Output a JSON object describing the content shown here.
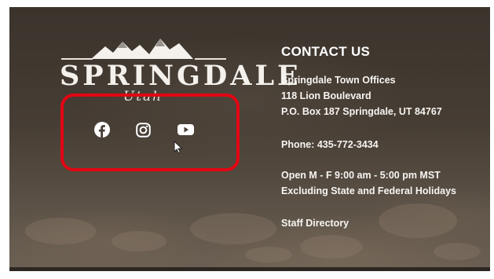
{
  "logo": {
    "wordmark": "SPRINGDALE",
    "script": "Utah"
  },
  "social": [
    {
      "icon": "facebook-icon",
      "label": "Facebook"
    },
    {
      "icon": "instagram-icon",
      "label": "Instagram"
    },
    {
      "icon": "youtube-icon",
      "label": "YouTube"
    }
  ],
  "contact": {
    "heading": "CONTACT US",
    "office_name": "Springdale Town Offices",
    "street": "118 Lion Boulevard",
    "po_box": "P.O. Box 187 Springdale, UT 84767",
    "phone": "Phone: 435-772-3434",
    "hours": "Open M - F 9:00 am - 5:00 pm MST",
    "holidays": "Excluding State and Federal Holidays",
    "staff_directory": "Staff Directory"
  },
  "colors": {
    "highlight": "#e30613",
    "text": "#ffffff",
    "background": "#463d34"
  }
}
